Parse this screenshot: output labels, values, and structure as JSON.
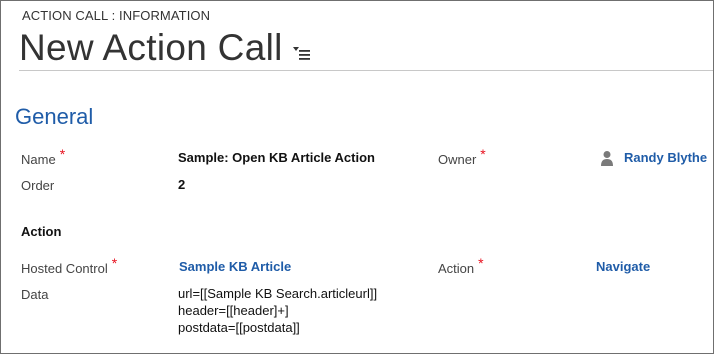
{
  "header": {
    "entity_label": "ACTION CALL : INFORMATION",
    "record_title": "New Action Call",
    "menu_icon": "form-selector-menu-icon"
  },
  "general": {
    "section_title": "General",
    "name": {
      "label": "Name",
      "value": "Sample: Open KB Article Action",
      "required": true
    },
    "order": {
      "label": "Order",
      "value": "2"
    },
    "owner": {
      "label": "Owner",
      "value": "Randy Blythe",
      "required": true,
      "icon": "user-icon"
    }
  },
  "action": {
    "section_title": "Action",
    "hosted_control": {
      "label": "Hosted Control",
      "value": "Sample KB Article",
      "required": true
    },
    "action": {
      "label": "Action",
      "value": "Navigate",
      "required": true
    },
    "data": {
      "label": "Data",
      "lines": [
        "url=[[Sample KB Search.articleurl]]",
        "header=[[header]+]",
        "postdata=[[postdata]]"
      ]
    }
  },
  "colors": {
    "accent": "#1f5ca8",
    "required": "#e8111f",
    "border": "#6f6f6f"
  }
}
